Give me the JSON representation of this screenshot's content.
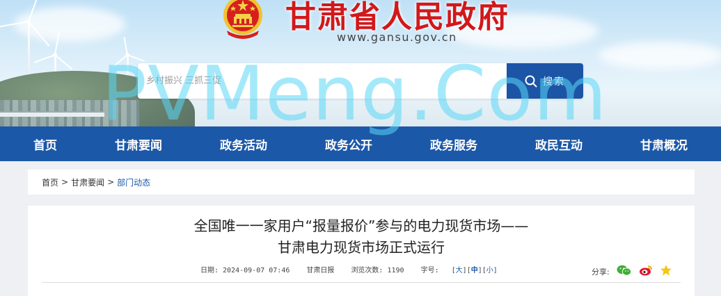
{
  "header": {
    "site_title": "甘肃省人民政府",
    "site_url": "www.gansu.gov.cn",
    "emblem_icon": "national-emblem-icon"
  },
  "search": {
    "placeholder": "乡村振兴 三抓三促",
    "button_label": "搜索",
    "icon": "search-icon"
  },
  "nav": {
    "items": [
      {
        "label": "首页"
      },
      {
        "label": "甘肃要闻"
      },
      {
        "label": "政务活动"
      },
      {
        "label": "政务公开"
      },
      {
        "label": "政务服务"
      },
      {
        "label": "政民互动"
      },
      {
        "label": "甘肃概况"
      }
    ]
  },
  "breadcrumb": {
    "items": [
      "首页",
      "甘肃要闻",
      "部门动态"
    ],
    "separator": ">"
  },
  "article": {
    "title_line1": "全国唯一一家用户“报量报价”参与的电力现货市场——",
    "title_line2": "甘肃电力现货市场正式运行",
    "date": "日期: 2024-09-07 07:46",
    "source": "甘肃日报",
    "views": "浏览次数: 1190",
    "font_size_label": "字号:",
    "font_size_options": {
      "large": "大",
      "medium": "中",
      "small": "小"
    },
    "share_label": "分享:",
    "share_icons": [
      "wechat-icon",
      "weibo-icon",
      "favorite-star-icon"
    ]
  },
  "watermark": {
    "text": "PVMeng.Com"
  },
  "colors": {
    "brand_blue": "#1c58a8",
    "title_red": "#d1181b",
    "watermark_cyan": "#5ad7f5"
  }
}
